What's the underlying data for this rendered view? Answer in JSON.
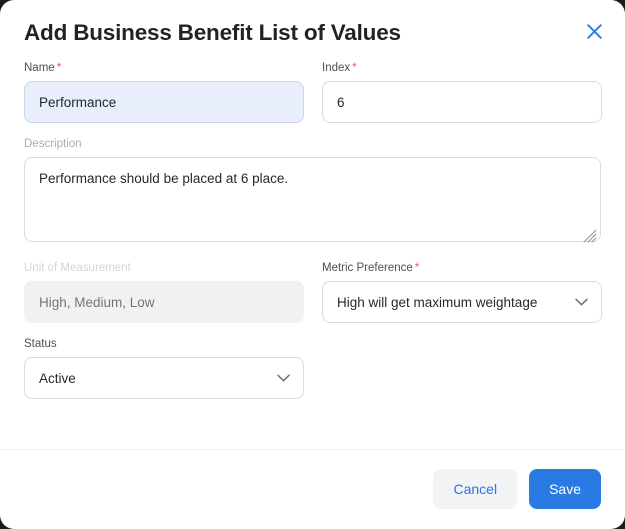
{
  "modal": {
    "title": "Add Business Benefit List of Values",
    "close_icon": "close-icon"
  },
  "form": {
    "name": {
      "label": "Name",
      "required_marker": "*",
      "value": "Performance",
      "placeholder": ""
    },
    "index": {
      "label": "Index",
      "required_marker": "*",
      "value": "6",
      "placeholder": ""
    },
    "description": {
      "label": "Description",
      "value": "Performance should be placed at 6 place.",
      "placeholder": ""
    },
    "unit_of_measurement": {
      "label": "Unit of Measurement",
      "value": "",
      "placeholder": "High, Medium, Low",
      "state": "disabled"
    },
    "metric_preference": {
      "label": "Metric Preference",
      "required_marker": "*",
      "value": "High will get maximum weightage",
      "chevron_icon": "chevron-down-icon"
    },
    "status": {
      "label": "Status",
      "value": "Active",
      "chevron_icon": "chevron-down-icon"
    }
  },
  "footer": {
    "cancel_label": "Cancel",
    "save_label": "Save"
  },
  "colors": {
    "accent_blue": "#2a7ae4",
    "required_red": "#f0506e",
    "focus_field_bg": "#e8eefb",
    "disabled_bg": "#f0f1f3"
  }
}
